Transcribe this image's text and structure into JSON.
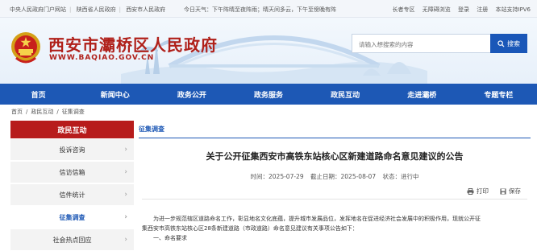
{
  "topbar": {
    "links": [
      "中央人民政府门户网站",
      "陕西省人民政府",
      "西安市人民政府"
    ],
    "weather": "今日天气：下午阵晴至夜阵雨；晴天间多云，下午至傍晚有阵",
    "right": [
      "长者专区",
      "无障碍浏览",
      "登录",
      "注册",
      "本站支持IPV6"
    ]
  },
  "header": {
    "title": "西安市灞桥区人民政府",
    "url": "WWW.BAQIAO.GOV.CN",
    "search_placeholder": "请输入想搜索的内容",
    "search_button": "搜索"
  },
  "nav": [
    "首页",
    "新闻中心",
    "政务公开",
    "政务服务",
    "政民互动",
    "走进灞桥",
    "专题专栏"
  ],
  "breadcrumb": [
    "首页",
    "政民互动",
    "征集调查"
  ],
  "sidebar": {
    "title": "政民互动",
    "items": [
      {
        "label": "投诉咨询",
        "active": false
      },
      {
        "label": "信访信箱",
        "active": false
      },
      {
        "label": "信件统计",
        "active": false
      },
      {
        "label": "征集调查",
        "active": true
      },
      {
        "label": "社会热点回应",
        "active": false
      }
    ]
  },
  "main": {
    "tab": "征集调查",
    "title": "关于公开征集西安市高铁东站核心区新建道路命名意见建议的公告",
    "meta": {
      "time": "时间：2025-07-29",
      "end": "截止日期：2025-08-07",
      "status": "状态：进行中"
    },
    "print": "打印",
    "save": "保存",
    "paragraphs": [
      "为进一步规范辖区道路命名工作，彰显地名文化底蕴，提升城市发展品位，发挥地名在促进经济社会发展中的积极作用，现就公开征",
      "集西安市高铁东站核心区28条新建道路（市政道路）命名意见建议有关事项公告如下：",
      "一、命名要求"
    ]
  },
  "colors": {
    "brand_blue": "#1d58b5",
    "brand_red": "#b71c1c"
  }
}
